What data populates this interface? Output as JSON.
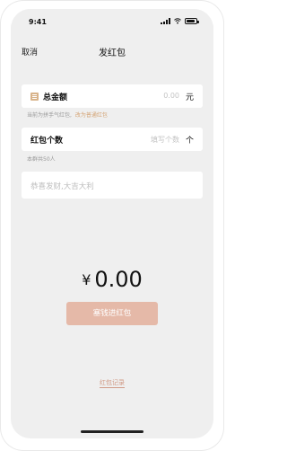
{
  "status_bar": {
    "time": "9:41"
  },
  "nav": {
    "cancel_label": "取消",
    "title": "发红包"
  },
  "amount": {
    "icon": "red-packet-icon",
    "label": "总金额",
    "value": "0.00",
    "unit": "元"
  },
  "amount_hint": {
    "text": "当前为拼手气红包,",
    "link": "改为普通红包"
  },
  "count": {
    "label": "红包个数",
    "placeholder": "填写个数",
    "unit": "个"
  },
  "count_hint": {
    "text": "本群共50人"
  },
  "message": {
    "placeholder": "恭喜发财,大吉大利"
  },
  "total": {
    "currency": "¥",
    "value": "0.00"
  },
  "submit": {
    "label": "塞钱进红包"
  },
  "records": {
    "label": "红包记录"
  },
  "colors": {
    "accent": "#d4a374",
    "button": "#e5b9a8",
    "background": "#efefef"
  }
}
